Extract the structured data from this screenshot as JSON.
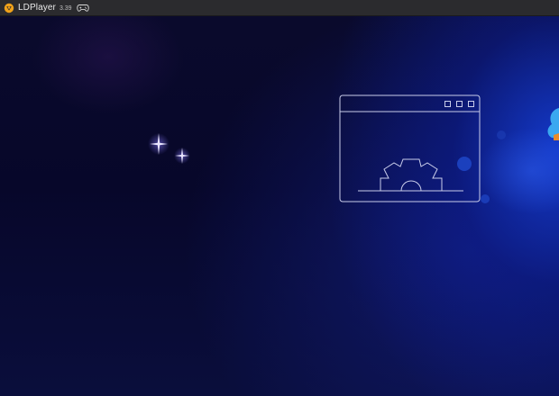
{
  "titlebar": {
    "app_name": "LDPlayer",
    "version": "3.39",
    "logo_icon": "ldplayer-logo-icon",
    "controller_icon": "gamepad-icon"
  },
  "screen": {
    "illustration_icon": "window-gear-icon",
    "decor_icons": [
      "sparkle-icon",
      "sparkle-icon"
    ],
    "side_icon": "cloud-mascot-icon"
  },
  "colors": {
    "titlebar": "#2b2b2e",
    "background": "#05061c",
    "accent_blue": "#1a4fe0",
    "logo_orange": "#f0a21a",
    "line_art": "#c9cdea"
  }
}
